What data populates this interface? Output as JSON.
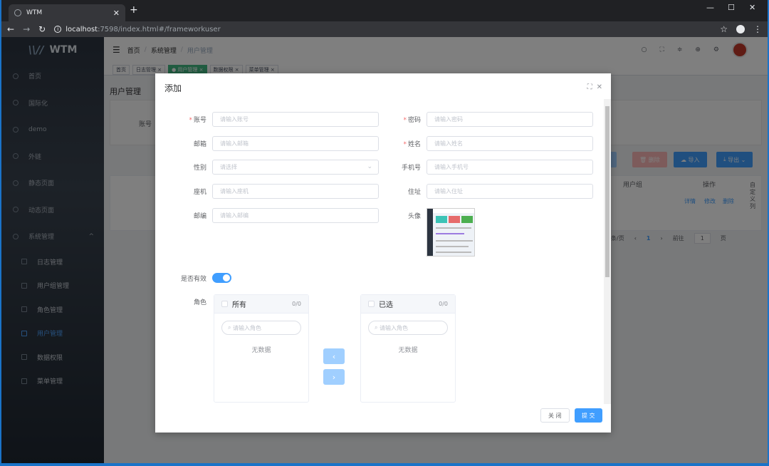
{
  "browser": {
    "tab_title": "WTM",
    "url_host": "localhost",
    "url_rest": ":7598/index.html#/frameworkuser",
    "window_controls": [
      "—",
      "☐",
      "✕"
    ]
  },
  "app": {
    "logo_mark": "\\\\//",
    "logo_text": "WTM",
    "sidebar": [
      {
        "label": "首页"
      },
      {
        "label": "国际化"
      },
      {
        "label": "demo"
      },
      {
        "label": "外链"
      },
      {
        "label": "静态页面"
      },
      {
        "label": "动态页面"
      },
      {
        "label": "系统管理"
      }
    ],
    "submenu": [
      {
        "label": "日志管理"
      },
      {
        "label": "用户组管理"
      },
      {
        "label": "角色管理"
      },
      {
        "label": "用户管理"
      },
      {
        "label": "数据权限"
      },
      {
        "label": "菜单管理"
      }
    ],
    "breadcrumb": [
      "首页",
      "系统管理",
      "用户管理"
    ],
    "tags": [
      "首页",
      "日志管理 ×",
      "● 用户管理 ×",
      "数据权限 ×",
      "菜单管理 ×"
    ],
    "page_title": "用户管理",
    "search_label": "账号",
    "buttons": {
      "delete": "删除",
      "import": "导入",
      "export": "导出"
    },
    "table_headers": {
      "group": "用户组",
      "ops": "操作",
      "custom": "自定义列"
    },
    "row_links": [
      "详情",
      "修改",
      "删除"
    ],
    "pager": {
      "per_page": "条/页",
      "page": "1",
      "goto": "前往",
      "goto_page": "1",
      "unit": "页"
    }
  },
  "dialog": {
    "title": "添加",
    "fields": {
      "account": {
        "label": "账号",
        "placeholder": "请输入账号",
        "required": true
      },
      "password": {
        "label": "密码",
        "placeholder": "请输入密码",
        "required": true
      },
      "email": {
        "label": "邮箱",
        "placeholder": "请输入邮箱"
      },
      "name": {
        "label": "姓名",
        "placeholder": "请输入姓名",
        "required": true
      },
      "gender": {
        "label": "性别",
        "placeholder": "请选择"
      },
      "mobile": {
        "label": "手机号",
        "placeholder": "请输入手机号"
      },
      "landline": {
        "label": "座机",
        "placeholder": "请输入座机"
      },
      "address": {
        "label": "住址",
        "placeholder": "请输入住址"
      },
      "zip": {
        "label": "邮编",
        "placeholder": "请输入邮编"
      },
      "avatar": {
        "label": "头像"
      }
    },
    "enabled_label": "是否有效",
    "enabled_value": true,
    "roles_label": "角色",
    "transfer": {
      "left_title": "所有",
      "left_count": "0/0",
      "right_title": "已选",
      "right_count": "0/0",
      "search_placeholder": "请输入角色",
      "empty_text": "无数据"
    },
    "close_button": "关 闭",
    "submit_button": "提 交"
  },
  "colors": {
    "primary": "#409eff",
    "success": "#42b983",
    "danger": "#f56c6c"
  }
}
